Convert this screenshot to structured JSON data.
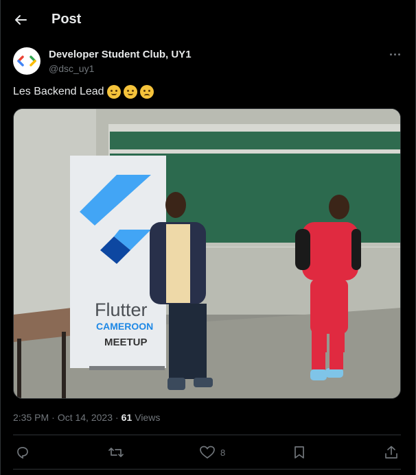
{
  "header": {
    "title": "Post"
  },
  "author": {
    "name": "Developer Student Club, UY1",
    "handle": "@dsc_uy1"
  },
  "post": {
    "text": "Les Backend Lead"
  },
  "media": {
    "banner_title": "Flutter",
    "banner_sub": "CAMEROON",
    "banner_meetup": "MEETUP"
  },
  "meta": {
    "time": "2:35 PM",
    "date": "Oct 14, 2023",
    "views_count": "61",
    "views_label": "Views",
    "sep": "·"
  },
  "actions": {
    "like_count": "8"
  },
  "colors": {
    "brand_flutter": "#42a5f5",
    "background": "#000000",
    "muted": "#71767b"
  }
}
